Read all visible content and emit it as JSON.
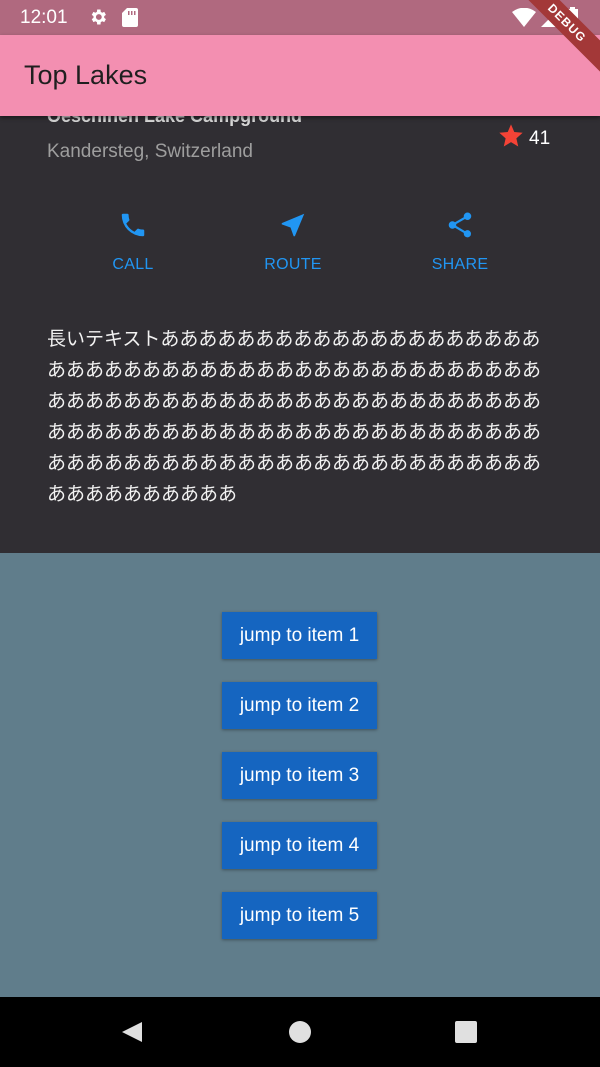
{
  "status_bar": {
    "time": "12:01"
  },
  "app_bar": {
    "title": "Top Lakes",
    "debug_banner": "DEBUG"
  },
  "place": {
    "name": "Oeschinen Lake Campground",
    "location": "Kandersteg, Switzerland",
    "rating_count": "41"
  },
  "actions": [
    {
      "label": "CALL",
      "icon": "phone-icon"
    },
    {
      "label": "ROUTE",
      "icon": "navigation-icon"
    },
    {
      "label": "SHARE",
      "icon": "share-icon"
    }
  ],
  "description": "長いテキストああああああああああああああああああああああああああああああああああああああああああああああああああああああああああああああああああああああああああああああああああああああああああああああああああああああああああああああああああああああああああああああああああああああ",
  "jump_buttons": [
    {
      "label": "jump to item 1"
    },
    {
      "label": "jump to item 2"
    },
    {
      "label": "jump to item 3"
    },
    {
      "label": "jump to item 4"
    },
    {
      "label": "jump to item 5"
    }
  ],
  "colors": {
    "status_bar": "#b0697f",
    "app_bar": "#f38fb1",
    "accent": "#2196f3",
    "star": "#f44336",
    "dark_background": "#302e33",
    "grey_background": "#607d8b",
    "button": "#1565c0"
  }
}
